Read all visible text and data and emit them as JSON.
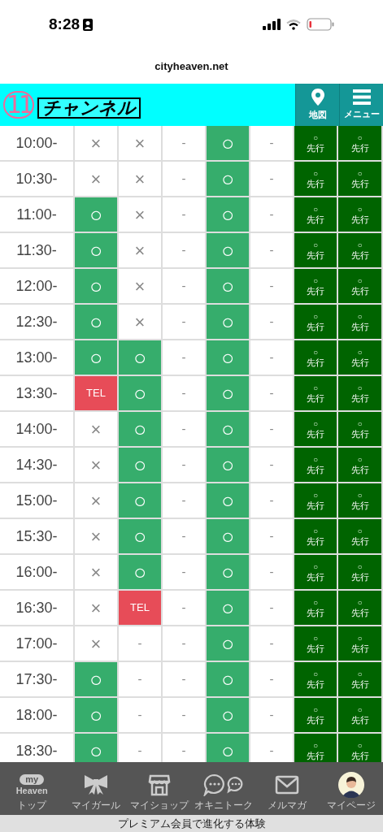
{
  "status_bar": {
    "time": "8:28"
  },
  "address_bar": {
    "url": "cityheaven.net"
  },
  "header": {
    "logo_number": "11",
    "logo_text": "チャンネル",
    "buttons": [
      {
        "kind": "map",
        "label": "地図"
      },
      {
        "kind": "menu",
        "label": "メニュー"
      }
    ]
  },
  "schedule": {
    "rows": [
      {
        "time": "10:00-",
        "cells": [
          {
            "kind": "cross",
            "text": "×"
          },
          {
            "kind": "cross",
            "text": "×"
          },
          {
            "kind": "dash",
            "text": "-"
          },
          {
            "kind": "circle",
            "text": "○"
          },
          {
            "kind": "dash",
            "text": "-"
          },
          {
            "kind": "advance",
            "text": "○",
            "label": "先行"
          },
          {
            "kind": "advance",
            "text": "○",
            "label": "先行"
          }
        ]
      },
      {
        "time": "10:30-",
        "cells": [
          {
            "kind": "cross",
            "text": "×"
          },
          {
            "kind": "cross",
            "text": "×"
          },
          {
            "kind": "dash",
            "text": "-"
          },
          {
            "kind": "circle",
            "text": "○"
          },
          {
            "kind": "dash",
            "text": "-"
          },
          {
            "kind": "advance",
            "text": "○",
            "label": "先行"
          },
          {
            "kind": "advance",
            "text": "○",
            "label": "先行"
          }
        ]
      },
      {
        "time": "11:00-",
        "cells": [
          {
            "kind": "circle",
            "text": "○"
          },
          {
            "kind": "cross",
            "text": "×"
          },
          {
            "kind": "dash",
            "text": "-"
          },
          {
            "kind": "circle",
            "text": "○"
          },
          {
            "kind": "dash",
            "text": "-"
          },
          {
            "kind": "advance",
            "text": "○",
            "label": "先行"
          },
          {
            "kind": "advance",
            "text": "○",
            "label": "先行"
          }
        ]
      },
      {
        "time": "11:30-",
        "cells": [
          {
            "kind": "circle",
            "text": "○"
          },
          {
            "kind": "cross",
            "text": "×"
          },
          {
            "kind": "dash",
            "text": "-"
          },
          {
            "kind": "circle",
            "text": "○"
          },
          {
            "kind": "dash",
            "text": "-"
          },
          {
            "kind": "advance",
            "text": "○",
            "label": "先行"
          },
          {
            "kind": "advance",
            "text": "○",
            "label": "先行"
          }
        ]
      },
      {
        "time": "12:00-",
        "cells": [
          {
            "kind": "circle",
            "text": "○"
          },
          {
            "kind": "cross",
            "text": "×"
          },
          {
            "kind": "dash",
            "text": "-"
          },
          {
            "kind": "circle",
            "text": "○"
          },
          {
            "kind": "dash",
            "text": "-"
          },
          {
            "kind": "advance",
            "text": "○",
            "label": "先行"
          },
          {
            "kind": "advance",
            "text": "○",
            "label": "先行"
          }
        ]
      },
      {
        "time": "12:30-",
        "cells": [
          {
            "kind": "circle",
            "text": "○"
          },
          {
            "kind": "cross",
            "text": "×"
          },
          {
            "kind": "dash",
            "text": "-"
          },
          {
            "kind": "circle",
            "text": "○"
          },
          {
            "kind": "dash",
            "text": "-"
          },
          {
            "kind": "advance",
            "text": "○",
            "label": "先行"
          },
          {
            "kind": "advance",
            "text": "○",
            "label": "先行"
          }
        ]
      },
      {
        "time": "13:00-",
        "cells": [
          {
            "kind": "circle",
            "text": "○"
          },
          {
            "kind": "circle",
            "text": "○"
          },
          {
            "kind": "dash",
            "text": "-"
          },
          {
            "kind": "circle",
            "text": "○"
          },
          {
            "kind": "dash",
            "text": "-"
          },
          {
            "kind": "advance",
            "text": "○",
            "label": "先行"
          },
          {
            "kind": "advance",
            "text": "○",
            "label": "先行"
          }
        ]
      },
      {
        "time": "13:30-",
        "cells": [
          {
            "kind": "tel",
            "text": "TEL"
          },
          {
            "kind": "circle",
            "text": "○"
          },
          {
            "kind": "dash",
            "text": "-"
          },
          {
            "kind": "circle",
            "text": "○"
          },
          {
            "kind": "dash",
            "text": "-"
          },
          {
            "kind": "advance",
            "text": "○",
            "label": "先行"
          },
          {
            "kind": "advance",
            "text": "○",
            "label": "先行"
          }
        ]
      },
      {
        "time": "14:00-",
        "cells": [
          {
            "kind": "cross",
            "text": "×"
          },
          {
            "kind": "circle",
            "text": "○"
          },
          {
            "kind": "dash",
            "text": "-"
          },
          {
            "kind": "circle",
            "text": "○"
          },
          {
            "kind": "dash",
            "text": "-"
          },
          {
            "kind": "advance",
            "text": "○",
            "label": "先行"
          },
          {
            "kind": "advance",
            "text": "○",
            "label": "先行"
          }
        ]
      },
      {
        "time": "14:30-",
        "cells": [
          {
            "kind": "cross",
            "text": "×"
          },
          {
            "kind": "circle",
            "text": "○"
          },
          {
            "kind": "dash",
            "text": "-"
          },
          {
            "kind": "circle",
            "text": "○"
          },
          {
            "kind": "dash",
            "text": "-"
          },
          {
            "kind": "advance",
            "text": "○",
            "label": "先行"
          },
          {
            "kind": "advance",
            "text": "○",
            "label": "先行"
          }
        ]
      },
      {
        "time": "15:00-",
        "cells": [
          {
            "kind": "cross",
            "text": "×"
          },
          {
            "kind": "circle",
            "text": "○"
          },
          {
            "kind": "dash",
            "text": "-"
          },
          {
            "kind": "circle",
            "text": "○"
          },
          {
            "kind": "dash",
            "text": "-"
          },
          {
            "kind": "advance",
            "text": "○",
            "label": "先行"
          },
          {
            "kind": "advance",
            "text": "○",
            "label": "先行"
          }
        ]
      },
      {
        "time": "15:30-",
        "cells": [
          {
            "kind": "cross",
            "text": "×"
          },
          {
            "kind": "circle",
            "text": "○"
          },
          {
            "kind": "dash",
            "text": "-"
          },
          {
            "kind": "circle",
            "text": "○"
          },
          {
            "kind": "dash",
            "text": "-"
          },
          {
            "kind": "advance",
            "text": "○",
            "label": "先行"
          },
          {
            "kind": "advance",
            "text": "○",
            "label": "先行"
          }
        ]
      },
      {
        "time": "16:00-",
        "cells": [
          {
            "kind": "cross",
            "text": "×"
          },
          {
            "kind": "circle",
            "text": "○"
          },
          {
            "kind": "dash",
            "text": "-"
          },
          {
            "kind": "circle",
            "text": "○"
          },
          {
            "kind": "dash",
            "text": "-"
          },
          {
            "kind": "advance",
            "text": "○",
            "label": "先行"
          },
          {
            "kind": "advance",
            "text": "○",
            "label": "先行"
          }
        ]
      },
      {
        "time": "16:30-",
        "cells": [
          {
            "kind": "cross",
            "text": "×"
          },
          {
            "kind": "tel",
            "text": "TEL"
          },
          {
            "kind": "dash",
            "text": "-"
          },
          {
            "kind": "circle",
            "text": "○"
          },
          {
            "kind": "dash",
            "text": "-"
          },
          {
            "kind": "advance",
            "text": "○",
            "label": "先行"
          },
          {
            "kind": "advance",
            "text": "○",
            "label": "先行"
          }
        ]
      },
      {
        "time": "17:00-",
        "cells": [
          {
            "kind": "cross",
            "text": "×"
          },
          {
            "kind": "dash",
            "text": "-"
          },
          {
            "kind": "dash",
            "text": "-"
          },
          {
            "kind": "circle",
            "text": "○"
          },
          {
            "kind": "dash",
            "text": "-"
          },
          {
            "kind": "advance",
            "text": "○",
            "label": "先行"
          },
          {
            "kind": "advance",
            "text": "○",
            "label": "先行"
          }
        ]
      },
      {
        "time": "17:30-",
        "cells": [
          {
            "kind": "circle",
            "text": "○"
          },
          {
            "kind": "dash",
            "text": "-"
          },
          {
            "kind": "dash",
            "text": "-"
          },
          {
            "kind": "circle",
            "text": "○"
          },
          {
            "kind": "dash",
            "text": "-"
          },
          {
            "kind": "advance",
            "text": "○",
            "label": "先行"
          },
          {
            "kind": "advance",
            "text": "○",
            "label": "先行"
          }
        ]
      },
      {
        "time": "18:00-",
        "cells": [
          {
            "kind": "circle",
            "text": "○"
          },
          {
            "kind": "dash",
            "text": "-"
          },
          {
            "kind": "dash",
            "text": "-"
          },
          {
            "kind": "circle",
            "text": "○"
          },
          {
            "kind": "dash",
            "text": "-"
          },
          {
            "kind": "advance",
            "text": "○",
            "label": "先行"
          },
          {
            "kind": "advance",
            "text": "○",
            "label": "先行"
          }
        ]
      },
      {
        "time": "18:30-",
        "cells": [
          {
            "kind": "circle",
            "text": "○"
          },
          {
            "kind": "dash",
            "text": "-"
          },
          {
            "kind": "dash",
            "text": "-"
          },
          {
            "kind": "circle",
            "text": "○"
          },
          {
            "kind": "dash",
            "text": "-"
          },
          {
            "kind": "advance",
            "text": "○",
            "label": "先行"
          },
          {
            "kind": "advance",
            "text": "○",
            "label": "先行"
          }
        ]
      }
    ]
  },
  "bottom_nav": {
    "items": [
      {
        "kind": "top",
        "label": "トップ",
        "logo_top": "my",
        "logo_bottom": "Heaven"
      },
      {
        "kind": "ribbon",
        "label": "マイガール"
      },
      {
        "kind": "shop",
        "label": "マイショップ"
      },
      {
        "kind": "chat",
        "label": "オキニトーク"
      },
      {
        "kind": "mail",
        "label": "メルマガ"
      },
      {
        "kind": "avatar",
        "label": "マイページ"
      }
    ]
  },
  "banner": {
    "text": "プレミアム会員で進化する体験"
  }
}
